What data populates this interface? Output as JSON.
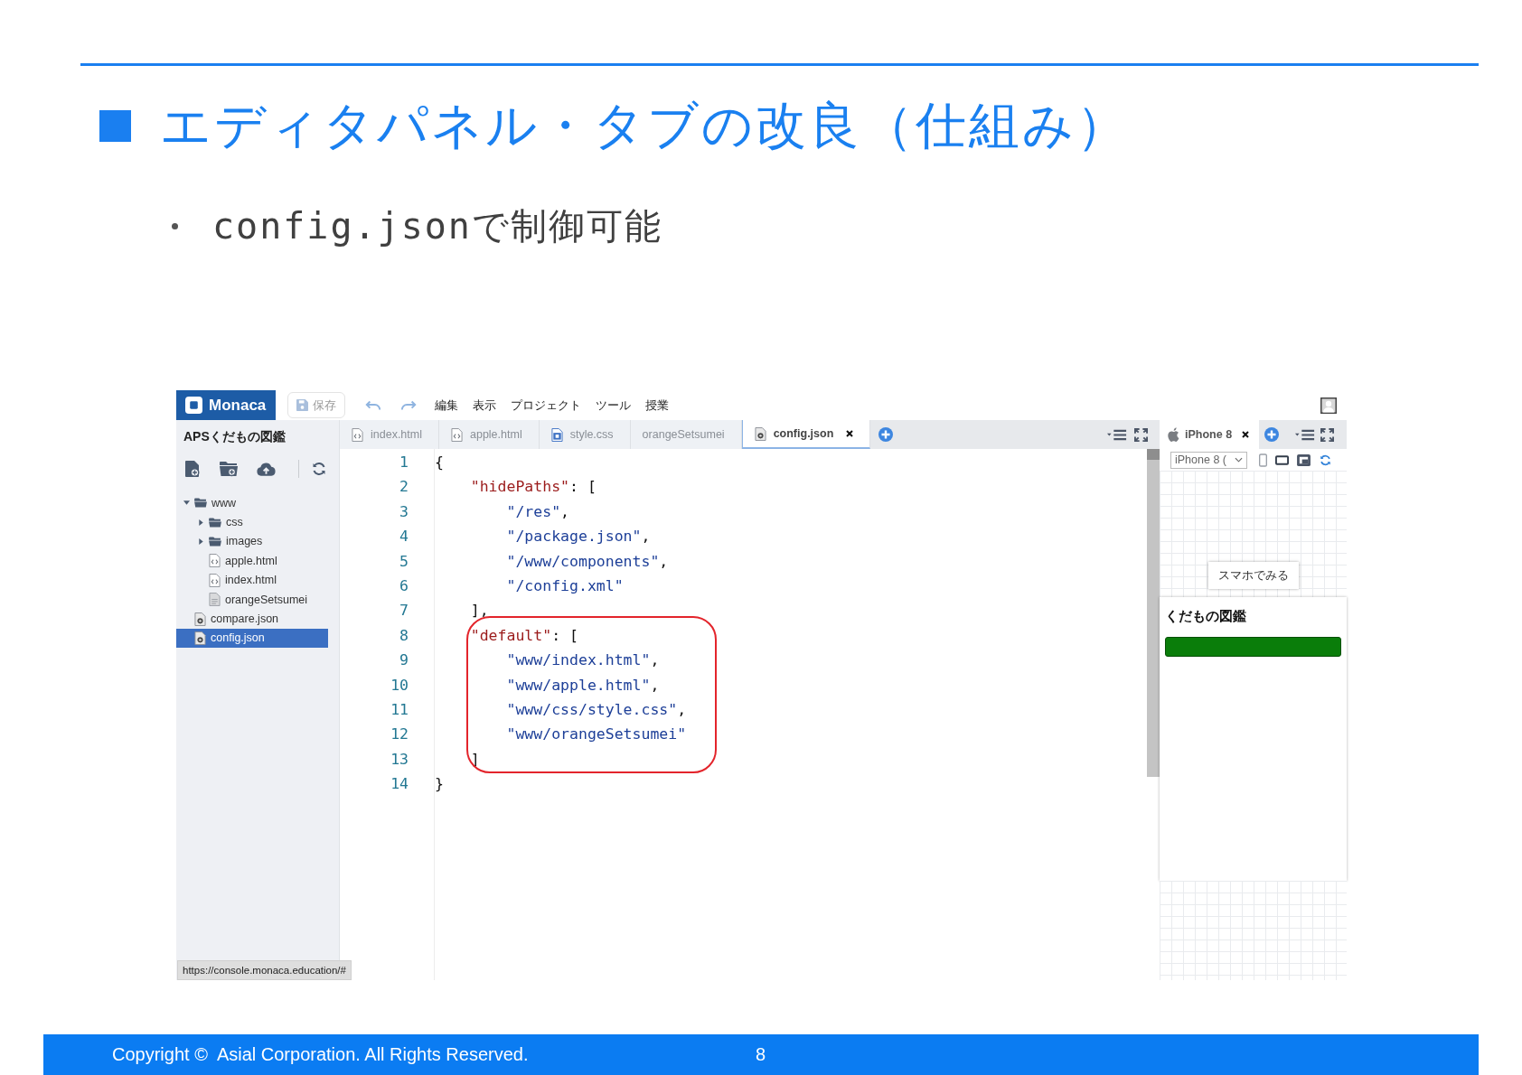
{
  "slide": {
    "title": "エディタパネル・タブの改良（仕組み）",
    "bullets": [
      "config.jsonで制御可能"
    ]
  },
  "ide": {
    "logo": "Monaca",
    "save": {
      "label": "保存",
      "disabled": true
    },
    "menus": [
      "編集",
      "表示",
      "プロジェクト",
      "ツール",
      "授業"
    ],
    "sidebar": {
      "title": "APSくだもの図鑑",
      "tree": [
        {
          "name": "www",
          "kind": "folder",
          "expanded": true,
          "selected": false,
          "children": [
            {
              "name": "css",
              "kind": "folder",
              "expanded": false,
              "selected": false
            },
            {
              "name": "images",
              "kind": "folder",
              "expanded": false,
              "selected": false
            },
            {
              "name": "apple.html",
              "kind": "html",
              "selected": false
            },
            {
              "name": "index.html",
              "kind": "html",
              "selected": false
            },
            {
              "name": "orangeSetsumei",
              "kind": "file",
              "selected": false
            }
          ]
        },
        {
          "name": "compare.json",
          "kind": "json",
          "selected": false
        },
        {
          "name": "config.json",
          "kind": "json",
          "selected": true
        }
      ]
    },
    "tabs": [
      {
        "label": "index.html",
        "kind": "html",
        "selected": false
      },
      {
        "label": "apple.html",
        "kind": "html",
        "selected": false
      },
      {
        "label": "style.css",
        "kind": "css",
        "selected": false
      },
      {
        "label": "orangeSetsumei",
        "kind": "plain",
        "selected": false
      },
      {
        "label": "config.json",
        "kind": "json",
        "selected": true
      }
    ],
    "editor": {
      "lines": [
        {
          "number": "1",
          "tokens": [
            {
              "kind": "punct",
              "text": "{"
            }
          ]
        },
        {
          "number": "2",
          "tokens": [
            {
              "kind": "key",
              "text": "    \"hidePaths\""
            },
            {
              "kind": "punct",
              "text": ": ["
            }
          ]
        },
        {
          "number": "3",
          "tokens": [
            {
              "kind": "string",
              "text": "        \"/res\""
            },
            {
              "kind": "punct",
              "text": ","
            }
          ]
        },
        {
          "number": "4",
          "tokens": [
            {
              "kind": "string",
              "text": "        \"/package.json\""
            },
            {
              "kind": "punct",
              "text": ","
            }
          ]
        },
        {
          "number": "5",
          "tokens": [
            {
              "kind": "string",
              "text": "        \"/www/components\""
            },
            {
              "kind": "punct",
              "text": ","
            }
          ]
        },
        {
          "number": "6",
          "tokens": [
            {
              "kind": "string",
              "text": "        \"/config.xml\""
            }
          ]
        },
        {
          "number": "7",
          "tokens": [
            {
              "kind": "punct",
              "text": "    ],"
            }
          ]
        },
        {
          "number": "8",
          "tokens": [
            {
              "kind": "key",
              "text": "    \"default\""
            },
            {
              "kind": "punct",
              "text": ": ["
            }
          ]
        },
        {
          "number": "9",
          "tokens": [
            {
              "kind": "string",
              "text": "        \"www/index.html\""
            },
            {
              "kind": "punct",
              "text": ","
            }
          ]
        },
        {
          "number": "10",
          "tokens": [
            {
              "kind": "string",
              "text": "        \"www/apple.html\""
            },
            {
              "kind": "punct",
              "text": ","
            }
          ]
        },
        {
          "number": "11",
          "tokens": [
            {
              "kind": "string",
              "text": "        \"www/css/style.css\""
            },
            {
              "kind": "punct",
              "text": ","
            }
          ]
        },
        {
          "number": "12",
          "tokens": [
            {
              "kind": "string",
              "text": "        \"www/orangeSetsumei\""
            }
          ]
        },
        {
          "number": "13",
          "tokens": [
            {
              "kind": "punct",
              "text": "    ]"
            }
          ]
        },
        {
          "number": "14",
          "tokens": [
            {
              "kind": "punct",
              "text": "}"
            }
          ]
        }
      ]
    },
    "status_url": "https://console.monaca.education/#"
  },
  "preview": {
    "device_tab": {
      "label": "iPhone 8",
      "selected": true
    },
    "device_select": "iPhone 8 (",
    "preview_button": "スマホでみる",
    "app": {
      "title": "くだもの図鑑"
    }
  },
  "footer": {
    "copyright": "Copyright ©  Asial Corporation. All Rights Reserved.",
    "page": "8"
  }
}
